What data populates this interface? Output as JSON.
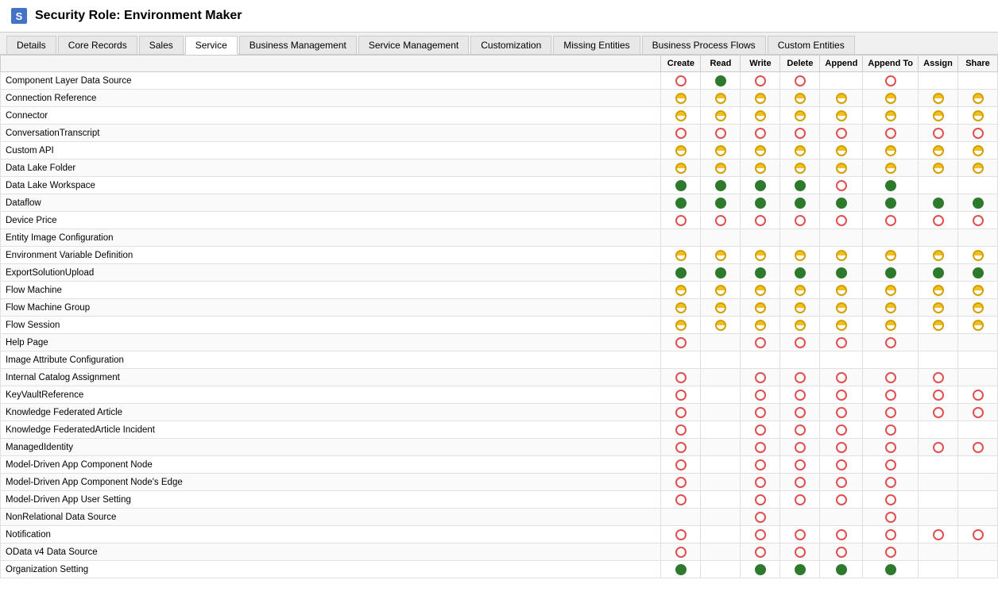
{
  "header": {
    "title": "Security Role: Environment Maker",
    "icon_label": "security-role-icon"
  },
  "tabs": [
    {
      "label": "Details",
      "active": false
    },
    {
      "label": "Core Records",
      "active": false
    },
    {
      "label": "Sales",
      "active": false
    },
    {
      "label": "Service",
      "active": true
    },
    {
      "label": "Business Management",
      "active": false
    },
    {
      "label": "Service Management",
      "active": false
    },
    {
      "label": "Customization",
      "active": false
    },
    {
      "label": "Missing Entities",
      "active": false
    },
    {
      "label": "Business Process Flows",
      "active": false
    },
    {
      "label": "Custom Entities",
      "active": false
    }
  ],
  "columns": [
    "",
    "Create",
    "Read",
    "Write",
    "Delete",
    "Append",
    "Append To",
    "Assign",
    "Share"
  ],
  "column_groups": [
    {
      "label": "Business Process Flows",
      "colspan": 2
    },
    {
      "label": "Custom Entities",
      "colspan": 2
    }
  ],
  "rows": [
    {
      "name": "Component Layer Data Source",
      "cells": [
        "er",
        "fg",
        "er",
        "er",
        "",
        "er",
        "",
        ""
      ]
    },
    {
      "name": "Connection Reference",
      "cells": [
        "hy",
        "hy",
        "hy",
        "hy",
        "hy",
        "hy",
        "hy",
        "hy"
      ]
    },
    {
      "name": "Connector",
      "cells": [
        "hy",
        "hy",
        "hy",
        "hy",
        "hy",
        "hy",
        "hy",
        "hy"
      ]
    },
    {
      "name": "ConversationTranscript",
      "cells": [
        "er",
        "er",
        "er",
        "er",
        "er",
        "er",
        "er",
        "er"
      ]
    },
    {
      "name": "Custom API",
      "cells": [
        "hy",
        "hy",
        "hy",
        "hy",
        "hy",
        "hy",
        "hy",
        "hy"
      ]
    },
    {
      "name": "Data Lake Folder",
      "cells": [
        "hy",
        "hy",
        "hy",
        "hy",
        "hy",
        "hy",
        "hy",
        "hy"
      ]
    },
    {
      "name": "Data Lake Workspace",
      "cells": [
        "fg",
        "fg",
        "fg",
        "fg",
        "er",
        "fg",
        "",
        ""
      ]
    },
    {
      "name": "Dataflow",
      "cells": [
        "fg",
        "fg",
        "fg",
        "fg",
        "fg",
        "fg",
        "fgb",
        "fg"
      ]
    },
    {
      "name": "Device Price",
      "cells": [
        "er",
        "er",
        "er",
        "er",
        "er",
        "er",
        "er",
        "er"
      ]
    },
    {
      "name": "Entity Image Configuration",
      "cells": [
        "",
        "",
        "",
        "",
        "",
        "",
        "",
        ""
      ]
    },
    {
      "name": "Environment Variable Definition",
      "cells": [
        "hy",
        "hy",
        "hy",
        "hy",
        "hy",
        "hy",
        "hy",
        "hy"
      ]
    },
    {
      "name": "ExportSolutionUpload",
      "cells": [
        "fg",
        "fg",
        "fgb",
        "fg",
        "fg",
        "fg",
        "fgb",
        "fg"
      ]
    },
    {
      "name": "Flow Machine",
      "cells": [
        "hy",
        "hy",
        "hy",
        "hy",
        "hy",
        "hy",
        "hy",
        "hy"
      ]
    },
    {
      "name": "Flow Machine Group",
      "cells": [
        "hy",
        "hy",
        "hy",
        "hy",
        "hy",
        "hy",
        "hy",
        "hy"
      ]
    },
    {
      "name": "Flow Session",
      "cells": [
        "hy",
        "hy",
        "hy",
        "hy",
        "hy",
        "hy",
        "hy",
        "hy"
      ]
    },
    {
      "name": "Help Page",
      "cells": [
        "er",
        "",
        "er",
        "er",
        "er",
        "er",
        "",
        ""
      ]
    },
    {
      "name": "Image Attribute Configuration",
      "cells": [
        "",
        "",
        "",
        "",
        "",
        "",
        "",
        ""
      ]
    },
    {
      "name": "Internal Catalog Assignment",
      "cells": [
        "er",
        "",
        "er",
        "er",
        "er",
        "er",
        "er",
        ""
      ]
    },
    {
      "name": "KeyVaultReference",
      "cells": [
        "er",
        "",
        "er",
        "er",
        "er",
        "er",
        "er",
        "er"
      ]
    },
    {
      "name": "Knowledge Federated Article",
      "cells": [
        "er",
        "",
        "er",
        "er",
        "er",
        "er",
        "er",
        "er"
      ]
    },
    {
      "name": "Knowledge FederatedArticle Incident",
      "cells": [
        "er",
        "",
        "er",
        "er",
        "er",
        "er",
        "",
        ""
      ]
    },
    {
      "name": "ManagedIdentity",
      "cells": [
        "er",
        "",
        "er",
        "er",
        "er",
        "er",
        "er",
        "er"
      ]
    },
    {
      "name": "Model-Driven App Component Node",
      "cells": [
        "er",
        "",
        "er",
        "er",
        "er",
        "er",
        "",
        ""
      ]
    },
    {
      "name": "Model-Driven App Component Node's Edge",
      "cells": [
        "er",
        "",
        "er",
        "er",
        "er",
        "er",
        "",
        ""
      ]
    },
    {
      "name": "Model-Driven App User Setting",
      "cells": [
        "er",
        "",
        "er",
        "er",
        "er",
        "er",
        "",
        ""
      ]
    },
    {
      "name": "NonRelational Data Source",
      "cells": [
        "",
        "",
        "er",
        "",
        "",
        "er",
        "",
        ""
      ]
    },
    {
      "name": "Notification",
      "cells": [
        "er",
        "",
        "er",
        "er",
        "er",
        "er",
        "er",
        "er"
      ]
    },
    {
      "name": "OData v4 Data Source",
      "cells": [
        "er",
        "",
        "er",
        "er",
        "er",
        "er",
        "",
        ""
      ]
    },
    {
      "name": "Organization Setting",
      "cells": [
        "fg",
        "",
        "fg",
        "fg",
        "fg",
        "fg",
        "",
        ""
      ]
    }
  ]
}
